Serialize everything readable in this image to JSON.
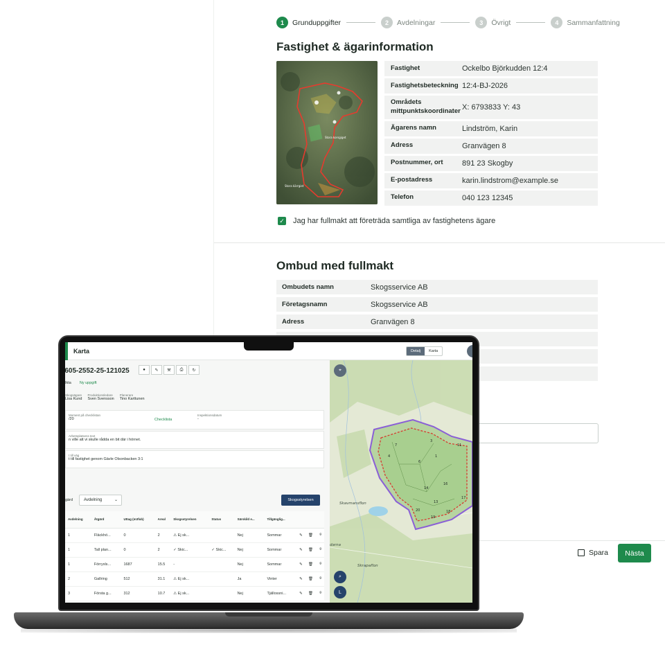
{
  "stepper": {
    "steps": [
      {
        "num": "1",
        "label": "Grunduppgifter"
      },
      {
        "num": "2",
        "label": "Avdelningar"
      },
      {
        "num": "3",
        "label": "Övrigt"
      },
      {
        "num": "4",
        "label": "Sammanfattning"
      }
    ]
  },
  "property": {
    "title": "Fastighet & ägarinformation",
    "map_labels": [
      "Stora korsgiget",
      "Stora kärrgiet"
    ],
    "rows": [
      {
        "key": "Fastighet",
        "value": "Ockelbo Björkudden 12:4"
      },
      {
        "key": "Fastighetsbeteckning",
        "value": "12:4-BJ-2026"
      },
      {
        "key": "Områdets mittpunktskoordinater",
        "value": "X: 6793833 Y: 43"
      },
      {
        "key": "Ägarens namn",
        "value": "Lindström, Karin"
      },
      {
        "key": "Adress",
        "value": "Granvägen 8"
      },
      {
        "key": "Postnummer, ort",
        "value": "891 23 Skogby"
      },
      {
        "key": "E-postadress",
        "value": "karin.lindstrom@example.se"
      },
      {
        "key": "Telefon",
        "value": "040 123 12345"
      }
    ],
    "consent_label": "Jag har fullmakt att företräda samtliga av fastighetens ägare"
  },
  "ombud": {
    "title": "Ombud med fullmakt",
    "rows": [
      {
        "key": "Ombudets namn",
        "value": "Skogsservice AB"
      },
      {
        "key": "Företagsnamn",
        "value": "Skogsservice AB"
      },
      {
        "key": "Adress",
        "value": "Granvägen 8"
      }
    ]
  },
  "footer": {
    "save_label": "Spara",
    "next_label": "Nästa"
  },
  "app": {
    "title": "Karta",
    "view_detail": "Detalj",
    "view_map": "Karta",
    "case_id": "-605-2552-25-121025",
    "status_left": "Ikta",
    "status_badge": "Ny uppgift",
    "people": [
      {
        "role": "Skogsägare",
        "name": "Lisa Kund"
      },
      {
        "role": "Produktionsledare",
        "name": "Sven Svensson"
      },
      {
        "role": "Planerare",
        "name": "Tino Karttunen"
      }
    ],
    "checklist_label": "Moment på checklistan",
    "checklist_value": "/20",
    "checklist_link": "Checklista",
    "inspection_label": "Inspektionsdatum",
    "inspection_value": "-",
    "note_label": "Arbetsplatsens text",
    "note_value": "n ville att vi skulle rådda en bit där i hörnet.",
    "route_label": "t till väg",
    "route_value": "t till fastighet genom Gävle Olsonbacken 3:1",
    "filter_prefix": "gärd",
    "filter_value": "Avdelning",
    "skog_button": "Skogsstyrelsen",
    "columns": [
      "Avdelning",
      "Åtgärd",
      "Uttag (m3fub)",
      "Areal",
      "Skogsstyrelsen",
      "Status",
      "Särskild e...",
      "Tillgänglig..."
    ],
    "rows": [
      {
        "avd": "1",
        "atgard": "Fläckhö...",
        "uttag": "0",
        "areal": "2",
        "skog": "⚠ Ej sk...",
        "skog_type": "warn",
        "status": "",
        "sarskild": "Nej",
        "tillg": "Sommar"
      },
      {
        "avd": "1",
        "atgard": "Tall plan...",
        "uttag": "0",
        "areal": "2",
        "skog": "✓ Skic...",
        "skog_type": "ok",
        "status": "✓ Skic...",
        "sarskild": "Nej",
        "tillg": "Sommar"
      },
      {
        "avd": "1",
        "atgard": "Förryxls...",
        "uttag": "1687",
        "areal": "15.5",
        "skog": "-",
        "skog_type": "muted",
        "status": "",
        "sarskild": "Nej",
        "tillg": "Sommar"
      },
      {
        "avd": "2",
        "atgard": "Gallring",
        "uttag": "512",
        "areal": "31.1",
        "skog": "⚠ Ej sk...",
        "skog_type": "warn",
        "status": "",
        "sarskild": "Ja",
        "tillg": "Vinter"
      },
      {
        "avd": "3",
        "atgard": "Första g...",
        "uttag": "312",
        "areal": "10.7",
        "skog": "⚠ Ej sk...",
        "skog_type": "warn",
        "status": "",
        "sarskild": "Nej",
        "tillg": "Tjällossni..."
      }
    ],
    "map_labels": [
      "Skavmansflon",
      "Skrapaflon",
      "darna"
    ],
    "stand_numbers": [
      "7",
      "3",
      "11",
      "1",
      "4",
      "6",
      "14",
      "16",
      "17",
      "13",
      "20",
      "18",
      "19"
    ]
  },
  "colors": {
    "accent": "#1e8a4c",
    "navy": "#25436b",
    "warning": "#e07b16"
  }
}
